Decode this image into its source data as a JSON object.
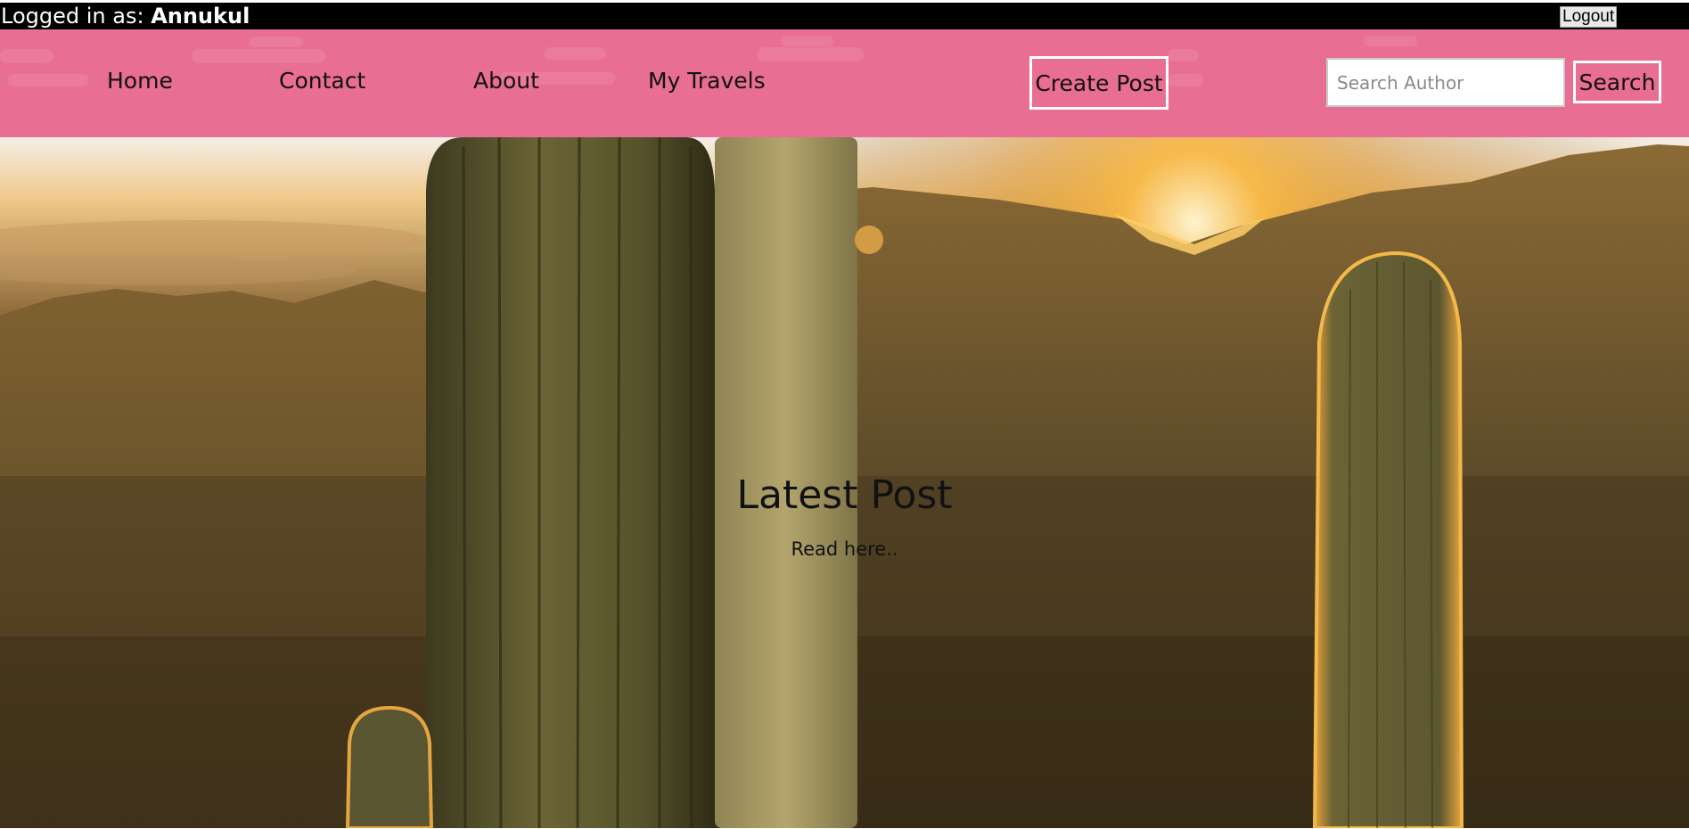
{
  "session": {
    "prefix": "Logged in as:",
    "username": "Annukul",
    "logout_label": "Logout"
  },
  "nav": {
    "links": [
      "Home",
      "Contact",
      "About",
      "My Travels"
    ],
    "create_post_label": "Create Post",
    "search_placeholder": "Search Author",
    "search_value": "",
    "search_label": "Search"
  },
  "hero": {
    "title": "Latest Post",
    "subtitle": "Read here.."
  },
  "colors": {
    "topbar": "#000000",
    "navbar": "#e86e93",
    "button_border": "#ffffff"
  },
  "icons": {
    "hero_image": "desert-cactus-sunset-photo"
  }
}
